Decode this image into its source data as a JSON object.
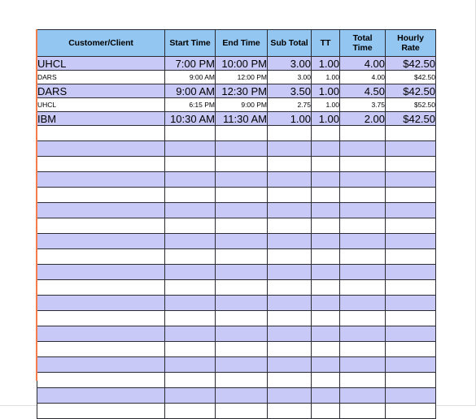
{
  "sheet": {
    "columns": [
      {
        "key": "client",
        "label": "Customer/Client",
        "align": "left"
      },
      {
        "key": "start",
        "label": "Start Time",
        "align": "right"
      },
      {
        "key": "end",
        "label": "End Time",
        "align": "right"
      },
      {
        "key": "sub",
        "label": "Sub Total",
        "align": "right"
      },
      {
        "key": "tt",
        "label": "TT",
        "align": "right"
      },
      {
        "key": "total",
        "label": "Total\nTime",
        "align": "right"
      },
      {
        "key": "rate",
        "label": "Hourly\nRate",
        "align": "right"
      }
    ],
    "header_labels": {
      "client": "Customer/Client",
      "start": "Start Time",
      "end": "End Time",
      "sub": "Sub Total",
      "tt": "TT",
      "total_line1": "Total",
      "total_line2": "Time",
      "rate_line1": "Hourly",
      "rate_line2": "Rate"
    },
    "rows": [
      {
        "style": "lavender",
        "client": "UHCL",
        "start": "7:00 PM",
        "end": "10:00 PM",
        "sub": "3.00",
        "tt": "1.00",
        "total": "4.00",
        "rate": "$42.50"
      },
      {
        "style": "white",
        "client": "DARS",
        "start": "9:00 AM",
        "end": "12:00 PM",
        "sub": "3.00",
        "tt": "1.00",
        "total": "4.00",
        "rate": "$42.50"
      },
      {
        "style": "lavender",
        "client": "DARS",
        "start": "9:00 AM",
        "end": "12:30 PM",
        "sub": "3.50",
        "tt": "1.00",
        "total": "4.50",
        "rate": "$42.50"
      },
      {
        "style": "white",
        "client": "UHCL",
        "start": "6:15 PM",
        "end": "9:00 PM",
        "sub": "2.75",
        "tt": "1.00",
        "total": "3.75",
        "rate": "$52.50"
      },
      {
        "style": "lavender",
        "client": "IBM",
        "start": "10:30 AM",
        "end": "11:30 AM",
        "sub": "1.00",
        "tt": "1.00",
        "total": "2.00",
        "rate": "$42.50"
      }
    ],
    "blank_row_count": 19,
    "blank_first_style": "white",
    "colors": {
      "header_fill": "#93C7F2",
      "banded_row_fill": "#C9C9F7",
      "plain_row_fill": "#FFFFFF",
      "grid_line": "#2b2b33",
      "left_rail": "#F47B4A",
      "page_background": "#FFFFFF"
    }
  }
}
